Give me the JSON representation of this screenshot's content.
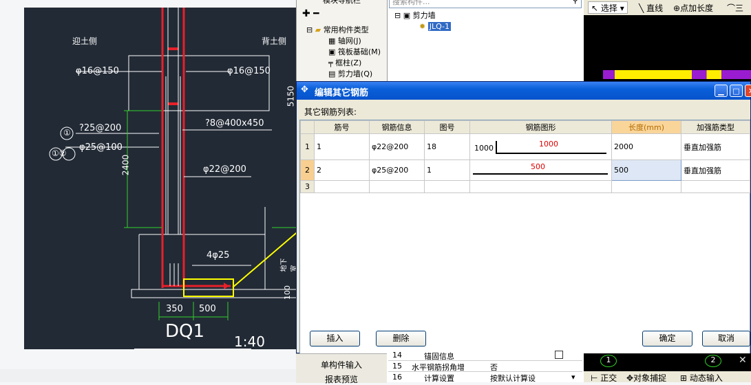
{
  "drawing": {
    "label_left": "迎土侧",
    "label_right": "背土侧",
    "r_top_left": "φ16@150",
    "r_top_right": "φ16@150",
    "mark_1": "①",
    "mark_2": "①②",
    "r_q25": "?25@200",
    "r_f25": "φ25@100",
    "r_q8": "?8@400x450",
    "r_f22": "φ22@200",
    "dim_2400": "2400",
    "dim_5150": "5150",
    "r_4f25": "4φ25",
    "dim_350": "350",
    "dim_500": "500",
    "dim_100": "100",
    "side_label": "地下室",
    "title": "DQ1",
    "scale": "1:40"
  },
  "left_panel": {
    "top_label": "模块导航栏",
    "tree": [
      {
        "label": "常用构件类型"
      },
      {
        "label": "轴网(J)"
      },
      {
        "label": "筏板基础(M)"
      },
      {
        "label": "框柱(Z)"
      },
      {
        "label": "剪力墙(Q)"
      }
    ],
    "bottom_items": [
      "单构件输入",
      "报表预览"
    ]
  },
  "component_tree": {
    "search_placeholder": "搜索构件...",
    "root": "剪力墙",
    "child": "JLQ-1"
  },
  "cad_toolbar": {
    "select": "选择",
    "line": "直线",
    "point_length": "点加长度",
    "arc": "三点"
  },
  "dialog": {
    "title": "编辑其它钢筋",
    "list_label": "其它钢筋列表:",
    "columns": [
      "筋号",
      "钢筋信息",
      "图号",
      "钢筋图形",
      "长度(mm)",
      "加强筋类型"
    ],
    "rows": [
      {
        "num": "1",
        "bar": "1",
        "info": "φ22@200",
        "fig": "18",
        "shape_left": "1000",
        "shape_right": "1000",
        "length": "2000",
        "type": "垂直加强筋"
      },
      {
        "num": "2",
        "bar": "2",
        "info": "φ25@200",
        "fig": "1",
        "shape_left": "",
        "shape_right": "500",
        "length": "500",
        "type": "垂直加强筋"
      },
      {
        "num": "3",
        "bar": "",
        "info": "",
        "fig": "",
        "shape_left": "",
        "shape_right": "",
        "length": "",
        "type": ""
      }
    ],
    "buttons": {
      "insert": "插入",
      "delete": "删除",
      "ok": "确定",
      "cancel": "取消"
    }
  },
  "props": {
    "rows": [
      {
        "num": "14",
        "name": "锚固信息",
        "value": ""
      },
      {
        "num": "15",
        "name": "水平钢筋拐角增",
        "value": "否"
      },
      {
        "num": "16",
        "name": "计算设置",
        "value": "按默认计算设"
      }
    ]
  },
  "status": {
    "ortho": "正交",
    "snap": "对象捕捉",
    "dynamic": "动态输入"
  },
  "axis_marks": [
    "1",
    "2"
  ],
  "colors": {
    "accent": "#0a5fd8",
    "highlight": "#f9d59a",
    "rebar": "#e8202a",
    "yellow": "#ffff00"
  }
}
